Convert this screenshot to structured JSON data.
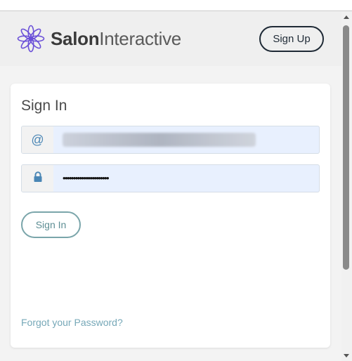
{
  "header": {
    "brand_part1": "Salon",
    "brand_part2": "Interactive",
    "signup_label": "Sign Up"
  },
  "form": {
    "title": "Sign In",
    "email_icon": "@",
    "email_value_hidden": true,
    "password_value": "••••••••••••••••••••••",
    "signin_label": "Sign In",
    "forgot_label": "Forgot your Password?"
  },
  "icons": {
    "logo": "flower-logo-icon",
    "email": "at-icon",
    "password": "lock-icon"
  },
  "colors": {
    "brand_purple": "#6a4fd8",
    "accent_teal": "#7aa5aa",
    "input_bg": "#e8f0fe",
    "link": "#76a8b8"
  }
}
